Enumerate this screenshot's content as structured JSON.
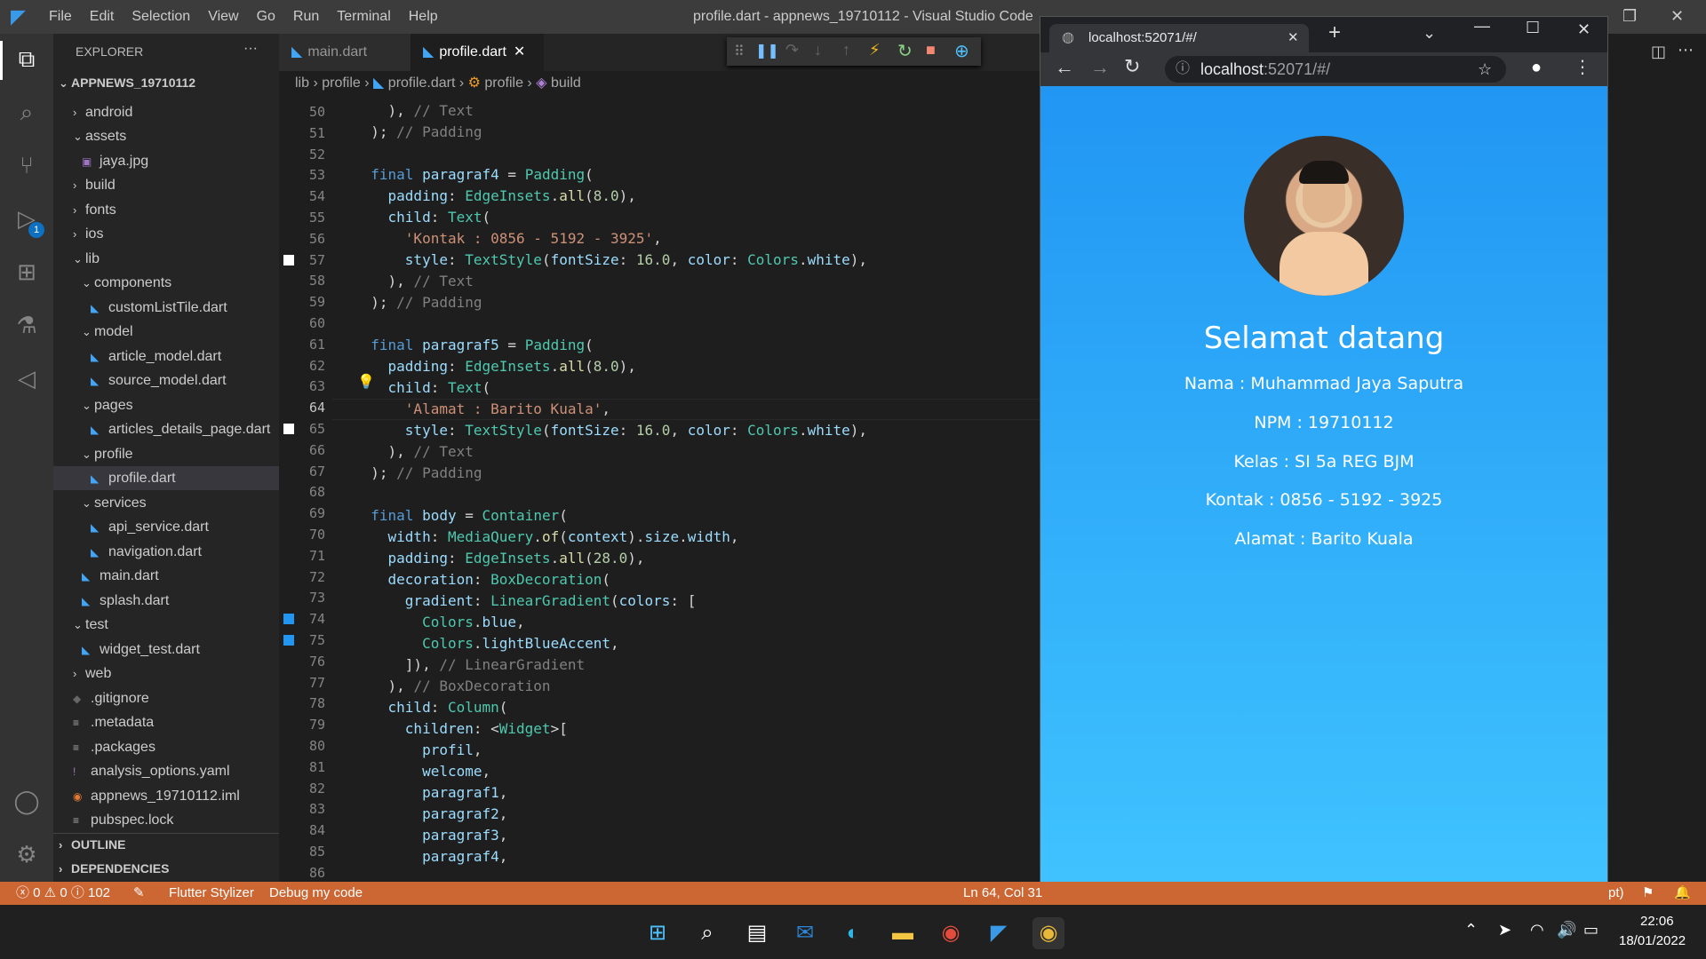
{
  "window": {
    "title": "profile.dart - appnews_19710112 - Visual Studio Code",
    "menu": [
      "File",
      "Edit",
      "Selection",
      "View",
      "Go",
      "Run",
      "Terminal",
      "Help"
    ]
  },
  "sidebar": {
    "header": "EXPLORER",
    "project": "APPNEWS_19710112",
    "items": [
      {
        "label": "android"
      },
      {
        "label": "assets"
      },
      {
        "label": "jaya.jpg"
      },
      {
        "label": "build"
      },
      {
        "label": "fonts"
      },
      {
        "label": "ios"
      },
      {
        "label": "lib"
      },
      {
        "label": "components"
      },
      {
        "label": "customListTile.dart"
      },
      {
        "label": "model"
      },
      {
        "label": "article_model.dart"
      },
      {
        "label": "source_model.dart"
      },
      {
        "label": "pages"
      },
      {
        "label": "articles_details_page.dart"
      },
      {
        "label": "profile"
      },
      {
        "label": "profile.dart"
      },
      {
        "label": "services"
      },
      {
        "label": "api_service.dart"
      },
      {
        "label": "navigation.dart"
      },
      {
        "label": "main.dart"
      },
      {
        "label": "splash.dart"
      },
      {
        "label": "test"
      },
      {
        "label": "widget_test.dart"
      },
      {
        "label": "web"
      },
      {
        "label": ".gitignore"
      },
      {
        "label": ".metadata"
      },
      {
        "label": ".packages"
      },
      {
        "label": "analysis_options.yaml"
      },
      {
        "label": "appnews_19710112.iml"
      },
      {
        "label": "pubspec.lock"
      }
    ],
    "outline": "OUTLINE",
    "dependencies": "DEPENDENCIES"
  },
  "editor": {
    "tabs": [
      {
        "label": "main.dart"
      },
      {
        "label": "profile.dart"
      }
    ],
    "breadcrumb": [
      "lib",
      "profile",
      "profile.dart",
      "profile",
      "build"
    ],
    "line_numbers": [
      "50",
      "51",
      "52",
      "53",
      "54",
      "55",
      "56",
      "57",
      "58",
      "59",
      "60",
      "61",
      "62",
      "63",
      "64",
      "65",
      "66",
      "67",
      "68",
      "69",
      "70",
      "71",
      "72",
      "73",
      "74",
      "75",
      "76",
      "77",
      "78",
      "79",
      "80",
      "81",
      "82",
      "83",
      "84",
      "85",
      "86"
    ]
  },
  "browser": {
    "tab_title": "localhost:52071/#/",
    "url_host": "localhost",
    "url_rest": ":52071/#/",
    "heading": "Selamat datang",
    "lines": [
      "Nama : Muhammad Jaya Saputra",
      "NPM : 19710112",
      "Kelas : SI 5a REG BJM",
      "Kontak : 0856 - 5192 - 3925",
      "Alamat : Barito Kuala"
    ]
  },
  "status": {
    "errors": "0",
    "warnings": "0",
    "info": "102",
    "stylizer": "Flutter Stylizer",
    "debug": "Debug my code",
    "position": "Ln 64, Col 31",
    "right_fragment": "pt)",
    "badge": "1"
  },
  "taskbar": {
    "time": "22:06",
    "date": "18/01/2022"
  },
  "colors": {
    "status_bar": "#cc6633",
    "gradient_top": "#2196f3",
    "gradient_bottom": "#40c4ff"
  }
}
